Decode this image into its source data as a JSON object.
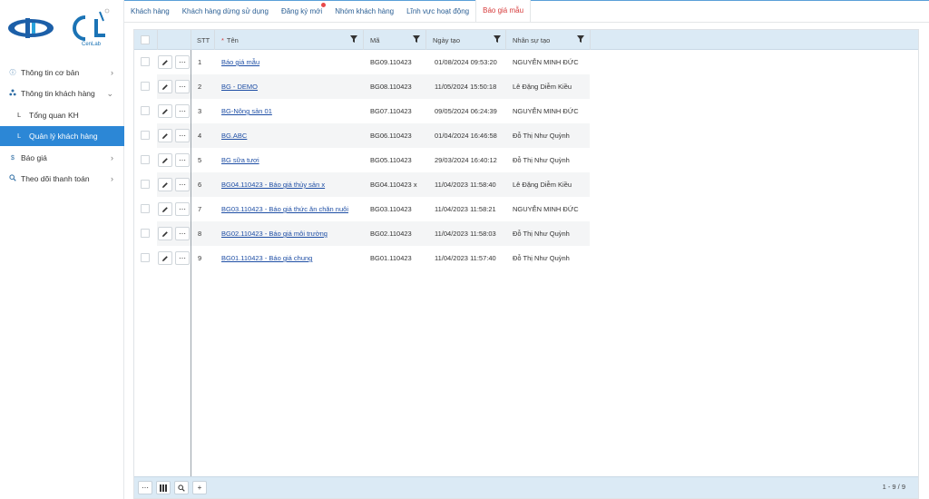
{
  "sidebar": {
    "logo2_text": "CenLab",
    "items": [
      {
        "label": "Thông tin cơ bản",
        "icon": "info-icon"
      },
      {
        "label": "Thông tin khách hàng",
        "icon": "people-icon"
      },
      {
        "label": "Tổng quan KH",
        "icon": "sub-item-marker"
      },
      {
        "label": "Quản lý khách hàng",
        "icon": "sub-item-marker",
        "active": true
      },
      {
        "label": "Báo giá",
        "icon": "dollar-icon"
      },
      {
        "label": "Theo dõi thanh toán",
        "icon": "search-icon"
      }
    ]
  },
  "tabs": [
    {
      "label": "Khách hàng"
    },
    {
      "label": "Khách hàng dừng sử dụng"
    },
    {
      "label": "Đăng ký mới"
    },
    {
      "label": "Nhóm khách hàng"
    },
    {
      "label": "Lĩnh vực hoạt động"
    },
    {
      "label": "Báo giá mẫu",
      "active": true
    }
  ],
  "table": {
    "columns": {
      "stt": "STT",
      "required_mark": "*",
      "ten": "Tên",
      "ma": "Mã",
      "ngay_tao": "Ngày tạo",
      "nhan_su_tao": "Nhân sự tạo"
    },
    "rows": [
      {
        "stt": "1",
        "ten": "Báo giá mẫu",
        "ma": "BG09.110423",
        "ngay_tao": "01/08/2024 09:53:20",
        "nhan_su_tao": "NGUYỄN MINH ĐỨC"
      },
      {
        "stt": "2",
        "ten": "BG - DEMO",
        "ma": "BG08.110423",
        "ngay_tao": "11/05/2024 15:50:18",
        "nhan_su_tao": "Lê Đặng Diễm Kiều"
      },
      {
        "stt": "3",
        "ten": "BG-Nông sản 01",
        "ma": "BG07.110423",
        "ngay_tao": "09/05/2024 06:24:39",
        "nhan_su_tao": "NGUYỄN MINH ĐỨC"
      },
      {
        "stt": "4",
        "ten": "BG.ABC",
        "ma": "BG06.110423",
        "ngay_tao": "01/04/2024 16:46:58",
        "nhan_su_tao": "Đỗ Thị Như Quỳnh"
      },
      {
        "stt": "5",
        "ten": "BG sữa tươi",
        "ma": "BG05.110423",
        "ngay_tao": "29/03/2024 16:40:12",
        "nhan_su_tao": "Đỗ Thị Như Quỳnh"
      },
      {
        "stt": "6",
        "ten": "BG04.110423 - Báo giá thủy sản x",
        "ma": "BG04.110423 x",
        "ngay_tao": "11/04/2023 11:58:40",
        "nhan_su_tao": "Lê Đặng Diễm Kiều"
      },
      {
        "stt": "7",
        "ten": "BG03.110423 - Báo giá thức ăn chăn nuôi",
        "ma": "BG03.110423",
        "ngay_tao": "11/04/2023 11:58:21",
        "nhan_su_tao": "NGUYỄN MINH ĐỨC"
      },
      {
        "stt": "8",
        "ten": "BG02.110423 - Báo giá môi trường",
        "ma": "BG02.110423",
        "ngay_tao": "11/04/2023 11:58:03",
        "nhan_su_tao": "Đỗ Thị Như Quỳnh"
      },
      {
        "stt": "9",
        "ten": "BG01.110423 - Báo giá chung",
        "ma": "BG01.110423",
        "ngay_tao": "11/04/2023 11:57:40",
        "nhan_su_tao": "Đỗ Thị Như Quỳnh"
      }
    ]
  },
  "footer": {
    "pager": "1 - 9 / 9"
  },
  "colors": {
    "accent": "#2c87d6",
    "link": "#1f4fa5",
    "active_tab": "#d63b3b",
    "header_bg": "#dbeaf5"
  }
}
